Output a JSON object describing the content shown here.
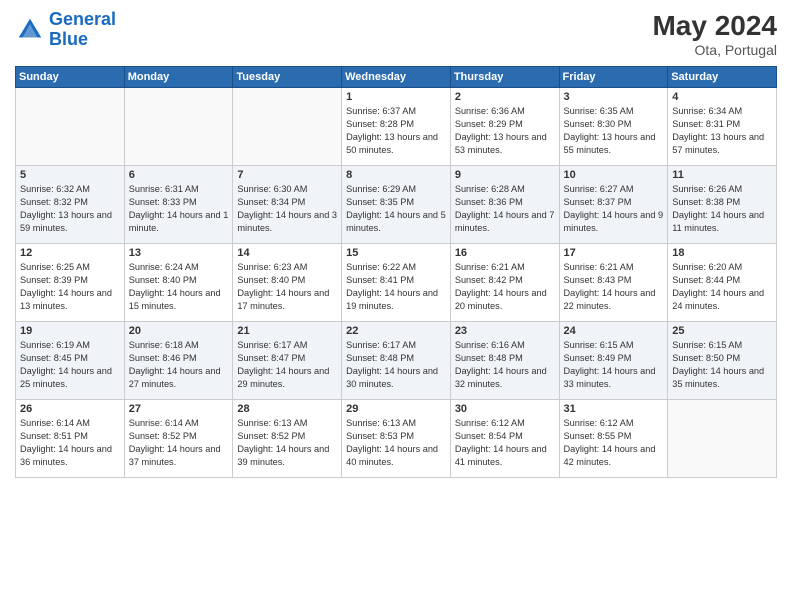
{
  "header": {
    "logo_general": "General",
    "logo_blue": "Blue",
    "month_year": "May 2024",
    "location": "Ota, Portugal"
  },
  "weekdays": [
    "Sunday",
    "Monday",
    "Tuesday",
    "Wednesday",
    "Thursday",
    "Friday",
    "Saturday"
  ],
  "weeks": [
    [
      {
        "day": "",
        "empty": true
      },
      {
        "day": "",
        "empty": true
      },
      {
        "day": "",
        "empty": true
      },
      {
        "day": "1",
        "sunrise": "6:37 AM",
        "sunset": "8:28 PM",
        "daylight": "13 hours and 50 minutes."
      },
      {
        "day": "2",
        "sunrise": "6:36 AM",
        "sunset": "8:29 PM",
        "daylight": "13 hours and 53 minutes."
      },
      {
        "day": "3",
        "sunrise": "6:35 AM",
        "sunset": "8:30 PM",
        "daylight": "13 hours and 55 minutes."
      },
      {
        "day": "4",
        "sunrise": "6:34 AM",
        "sunset": "8:31 PM",
        "daylight": "13 hours and 57 minutes."
      }
    ],
    [
      {
        "day": "5",
        "sunrise": "6:32 AM",
        "sunset": "8:32 PM",
        "daylight": "13 hours and 59 minutes."
      },
      {
        "day": "6",
        "sunrise": "6:31 AM",
        "sunset": "8:33 PM",
        "daylight": "14 hours and 1 minute."
      },
      {
        "day": "7",
        "sunrise": "6:30 AM",
        "sunset": "8:34 PM",
        "daylight": "14 hours and 3 minutes."
      },
      {
        "day": "8",
        "sunrise": "6:29 AM",
        "sunset": "8:35 PM",
        "daylight": "14 hours and 5 minutes."
      },
      {
        "day": "9",
        "sunrise": "6:28 AM",
        "sunset": "8:36 PM",
        "daylight": "14 hours and 7 minutes."
      },
      {
        "day": "10",
        "sunrise": "6:27 AM",
        "sunset": "8:37 PM",
        "daylight": "14 hours and 9 minutes."
      },
      {
        "day": "11",
        "sunrise": "6:26 AM",
        "sunset": "8:38 PM",
        "daylight": "14 hours and 11 minutes."
      }
    ],
    [
      {
        "day": "12",
        "sunrise": "6:25 AM",
        "sunset": "8:39 PM",
        "daylight": "14 hours and 13 minutes."
      },
      {
        "day": "13",
        "sunrise": "6:24 AM",
        "sunset": "8:40 PM",
        "daylight": "14 hours and 15 minutes."
      },
      {
        "day": "14",
        "sunrise": "6:23 AM",
        "sunset": "8:40 PM",
        "daylight": "14 hours and 17 minutes."
      },
      {
        "day": "15",
        "sunrise": "6:22 AM",
        "sunset": "8:41 PM",
        "daylight": "14 hours and 19 minutes."
      },
      {
        "day": "16",
        "sunrise": "6:21 AM",
        "sunset": "8:42 PM",
        "daylight": "14 hours and 20 minutes."
      },
      {
        "day": "17",
        "sunrise": "6:21 AM",
        "sunset": "8:43 PM",
        "daylight": "14 hours and 22 minutes."
      },
      {
        "day": "18",
        "sunrise": "6:20 AM",
        "sunset": "8:44 PM",
        "daylight": "14 hours and 24 minutes."
      }
    ],
    [
      {
        "day": "19",
        "sunrise": "6:19 AM",
        "sunset": "8:45 PM",
        "daylight": "14 hours and 25 minutes."
      },
      {
        "day": "20",
        "sunrise": "6:18 AM",
        "sunset": "8:46 PM",
        "daylight": "14 hours and 27 minutes."
      },
      {
        "day": "21",
        "sunrise": "6:17 AM",
        "sunset": "8:47 PM",
        "daylight": "14 hours and 29 minutes."
      },
      {
        "day": "22",
        "sunrise": "6:17 AM",
        "sunset": "8:48 PM",
        "daylight": "14 hours and 30 minutes."
      },
      {
        "day": "23",
        "sunrise": "6:16 AM",
        "sunset": "8:48 PM",
        "daylight": "14 hours and 32 minutes."
      },
      {
        "day": "24",
        "sunrise": "6:15 AM",
        "sunset": "8:49 PM",
        "daylight": "14 hours and 33 minutes."
      },
      {
        "day": "25",
        "sunrise": "6:15 AM",
        "sunset": "8:50 PM",
        "daylight": "14 hours and 35 minutes."
      }
    ],
    [
      {
        "day": "26",
        "sunrise": "6:14 AM",
        "sunset": "8:51 PM",
        "daylight": "14 hours and 36 minutes."
      },
      {
        "day": "27",
        "sunrise": "6:14 AM",
        "sunset": "8:52 PM",
        "daylight": "14 hours and 37 minutes."
      },
      {
        "day": "28",
        "sunrise": "6:13 AM",
        "sunset": "8:52 PM",
        "daylight": "14 hours and 39 minutes."
      },
      {
        "day": "29",
        "sunrise": "6:13 AM",
        "sunset": "8:53 PM",
        "daylight": "14 hours and 40 minutes."
      },
      {
        "day": "30",
        "sunrise": "6:12 AM",
        "sunset": "8:54 PM",
        "daylight": "14 hours and 41 minutes."
      },
      {
        "day": "31",
        "sunrise": "6:12 AM",
        "sunset": "8:55 PM",
        "daylight": "14 hours and 42 minutes."
      },
      {
        "day": "",
        "empty": true
      }
    ]
  ]
}
